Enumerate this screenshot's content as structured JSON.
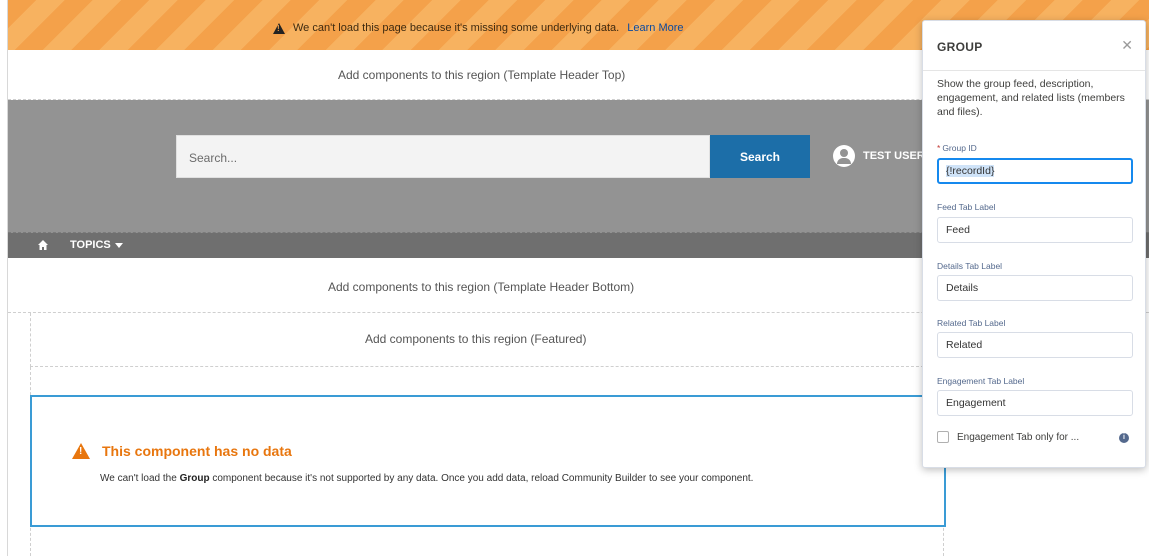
{
  "banner": {
    "message": "We can't load this page because it's missing some underlying data.",
    "link": "Learn More"
  },
  "regions": {
    "header_top": "Add components to this region (Template Header Top)",
    "header_bottom": "Add components to this region (Template Header Bottom)",
    "featured": "Add components to this region (Featured)"
  },
  "header": {
    "search_placeholder": "Search...",
    "search_button": "Search",
    "user_name": "TEST USER"
  },
  "nav": {
    "topics": "TOPICS"
  },
  "nodata": {
    "title": "This component has no data",
    "msg_before": "We can't load the ",
    "msg_bold": "Group",
    "msg_after": " component because it's not supported by any data. Once you add data, reload Community Builder to see your component."
  },
  "panel": {
    "title": "GROUP",
    "description": "Show the group feed, description, engagement, and related lists (members and files).",
    "fields": {
      "group_id_label": "Group ID",
      "group_id_value": "{!recordId}",
      "feed_label": "Feed Tab Label",
      "feed_value": "Feed",
      "details_label": "Details Tab Label",
      "details_value": "Details",
      "related_label": "Related Tab Label",
      "related_value": "Related",
      "engagement_label": "Engagement Tab Label",
      "engagement_value": "Engagement"
    },
    "checkbox_label": "Engagement Tab only for ..."
  },
  "colors": {
    "banner": "#f4a14a",
    "header_gray": "#939393",
    "nav_gray": "#6f6f6f",
    "search_button": "#1c6ea8",
    "nodata_title": "#e8760e",
    "card_border": "#3a9bd5",
    "focus": "#1589ee"
  }
}
